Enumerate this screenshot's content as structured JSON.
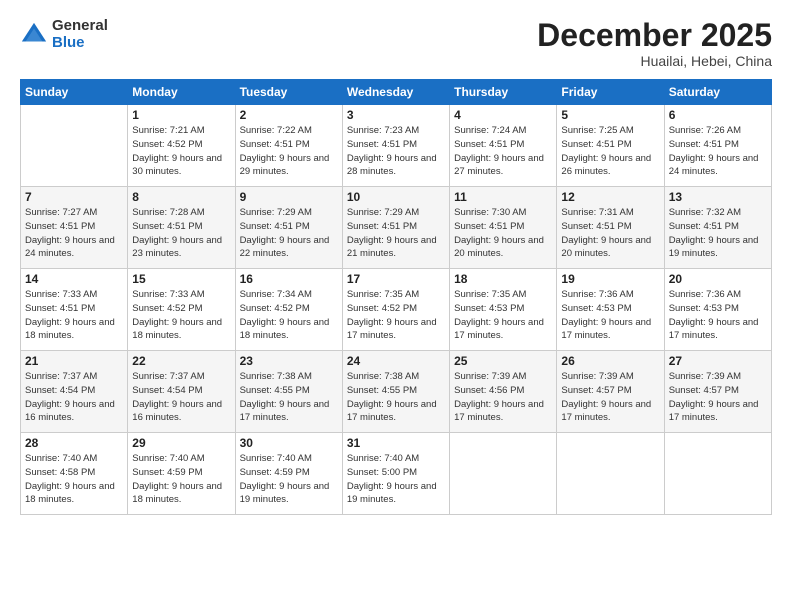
{
  "logo": {
    "general": "General",
    "blue": "Blue"
  },
  "header": {
    "month": "December 2025",
    "location": "Huailai, Hebei, China"
  },
  "weekdays": [
    "Sunday",
    "Monday",
    "Tuesday",
    "Wednesday",
    "Thursday",
    "Friday",
    "Saturday"
  ],
  "weeks": [
    [
      {
        "day": "",
        "sunrise": "",
        "sunset": "",
        "daylight": ""
      },
      {
        "day": "1",
        "sunrise": "7:21 AM",
        "sunset": "4:52 PM",
        "daylight": "9 hours and 30 minutes."
      },
      {
        "day": "2",
        "sunrise": "7:22 AM",
        "sunset": "4:51 PM",
        "daylight": "9 hours and 29 minutes."
      },
      {
        "day": "3",
        "sunrise": "7:23 AM",
        "sunset": "4:51 PM",
        "daylight": "9 hours and 28 minutes."
      },
      {
        "day": "4",
        "sunrise": "7:24 AM",
        "sunset": "4:51 PM",
        "daylight": "9 hours and 27 minutes."
      },
      {
        "day": "5",
        "sunrise": "7:25 AM",
        "sunset": "4:51 PM",
        "daylight": "9 hours and 26 minutes."
      },
      {
        "day": "6",
        "sunrise": "7:26 AM",
        "sunset": "4:51 PM",
        "daylight": "9 hours and 24 minutes."
      }
    ],
    [
      {
        "day": "7",
        "sunrise": "7:27 AM",
        "sunset": "4:51 PM",
        "daylight": "9 hours and 24 minutes."
      },
      {
        "day": "8",
        "sunrise": "7:28 AM",
        "sunset": "4:51 PM",
        "daylight": "9 hours and 23 minutes."
      },
      {
        "day": "9",
        "sunrise": "7:29 AM",
        "sunset": "4:51 PM",
        "daylight": "9 hours and 22 minutes."
      },
      {
        "day": "10",
        "sunrise": "7:29 AM",
        "sunset": "4:51 PM",
        "daylight": "9 hours and 21 minutes."
      },
      {
        "day": "11",
        "sunrise": "7:30 AM",
        "sunset": "4:51 PM",
        "daylight": "9 hours and 20 minutes."
      },
      {
        "day": "12",
        "sunrise": "7:31 AM",
        "sunset": "4:51 PM",
        "daylight": "9 hours and 20 minutes."
      },
      {
        "day": "13",
        "sunrise": "7:32 AM",
        "sunset": "4:51 PM",
        "daylight": "9 hours and 19 minutes."
      }
    ],
    [
      {
        "day": "14",
        "sunrise": "7:33 AM",
        "sunset": "4:51 PM",
        "daylight": "9 hours and 18 minutes."
      },
      {
        "day": "15",
        "sunrise": "7:33 AM",
        "sunset": "4:52 PM",
        "daylight": "9 hours and 18 minutes."
      },
      {
        "day": "16",
        "sunrise": "7:34 AM",
        "sunset": "4:52 PM",
        "daylight": "9 hours and 18 minutes."
      },
      {
        "day": "17",
        "sunrise": "7:35 AM",
        "sunset": "4:52 PM",
        "daylight": "9 hours and 17 minutes."
      },
      {
        "day": "18",
        "sunrise": "7:35 AM",
        "sunset": "4:53 PM",
        "daylight": "9 hours and 17 minutes."
      },
      {
        "day": "19",
        "sunrise": "7:36 AM",
        "sunset": "4:53 PM",
        "daylight": "9 hours and 17 minutes."
      },
      {
        "day": "20",
        "sunrise": "7:36 AM",
        "sunset": "4:53 PM",
        "daylight": "9 hours and 17 minutes."
      }
    ],
    [
      {
        "day": "21",
        "sunrise": "7:37 AM",
        "sunset": "4:54 PM",
        "daylight": "9 hours and 16 minutes."
      },
      {
        "day": "22",
        "sunrise": "7:37 AM",
        "sunset": "4:54 PM",
        "daylight": "9 hours and 16 minutes."
      },
      {
        "day": "23",
        "sunrise": "7:38 AM",
        "sunset": "4:55 PM",
        "daylight": "9 hours and 17 minutes."
      },
      {
        "day": "24",
        "sunrise": "7:38 AM",
        "sunset": "4:55 PM",
        "daylight": "9 hours and 17 minutes."
      },
      {
        "day": "25",
        "sunrise": "7:39 AM",
        "sunset": "4:56 PM",
        "daylight": "9 hours and 17 minutes."
      },
      {
        "day": "26",
        "sunrise": "7:39 AM",
        "sunset": "4:57 PM",
        "daylight": "9 hours and 17 minutes."
      },
      {
        "day": "27",
        "sunrise": "7:39 AM",
        "sunset": "4:57 PM",
        "daylight": "9 hours and 17 minutes."
      }
    ],
    [
      {
        "day": "28",
        "sunrise": "7:40 AM",
        "sunset": "4:58 PM",
        "daylight": "9 hours and 18 minutes."
      },
      {
        "day": "29",
        "sunrise": "7:40 AM",
        "sunset": "4:59 PM",
        "daylight": "9 hours and 18 minutes."
      },
      {
        "day": "30",
        "sunrise": "7:40 AM",
        "sunset": "4:59 PM",
        "daylight": "9 hours and 19 minutes."
      },
      {
        "day": "31",
        "sunrise": "7:40 AM",
        "sunset": "5:00 PM",
        "daylight": "9 hours and 19 minutes."
      },
      {
        "day": "",
        "sunrise": "",
        "sunset": "",
        "daylight": ""
      },
      {
        "day": "",
        "sunrise": "",
        "sunset": "",
        "daylight": ""
      },
      {
        "day": "",
        "sunrise": "",
        "sunset": "",
        "daylight": ""
      }
    ]
  ]
}
